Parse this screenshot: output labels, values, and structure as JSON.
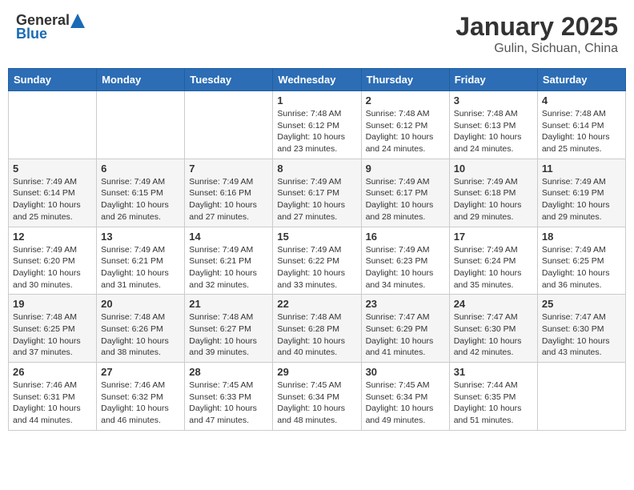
{
  "header": {
    "logo_general": "General",
    "logo_blue": "Blue",
    "month": "January 2025",
    "location": "Gulin, Sichuan, China"
  },
  "weekdays": [
    "Sunday",
    "Monday",
    "Tuesday",
    "Wednesday",
    "Thursday",
    "Friday",
    "Saturday"
  ],
  "weeks": [
    [
      {
        "day": "",
        "info": ""
      },
      {
        "day": "",
        "info": ""
      },
      {
        "day": "",
        "info": ""
      },
      {
        "day": "1",
        "info": "Sunrise: 7:48 AM\nSunset: 6:12 PM\nDaylight: 10 hours\nand 23 minutes."
      },
      {
        "day": "2",
        "info": "Sunrise: 7:48 AM\nSunset: 6:12 PM\nDaylight: 10 hours\nand 24 minutes."
      },
      {
        "day": "3",
        "info": "Sunrise: 7:48 AM\nSunset: 6:13 PM\nDaylight: 10 hours\nand 24 minutes."
      },
      {
        "day": "4",
        "info": "Sunrise: 7:48 AM\nSunset: 6:14 PM\nDaylight: 10 hours\nand 25 minutes."
      }
    ],
    [
      {
        "day": "5",
        "info": "Sunrise: 7:49 AM\nSunset: 6:14 PM\nDaylight: 10 hours\nand 25 minutes."
      },
      {
        "day": "6",
        "info": "Sunrise: 7:49 AM\nSunset: 6:15 PM\nDaylight: 10 hours\nand 26 minutes."
      },
      {
        "day": "7",
        "info": "Sunrise: 7:49 AM\nSunset: 6:16 PM\nDaylight: 10 hours\nand 27 minutes."
      },
      {
        "day": "8",
        "info": "Sunrise: 7:49 AM\nSunset: 6:17 PM\nDaylight: 10 hours\nand 27 minutes."
      },
      {
        "day": "9",
        "info": "Sunrise: 7:49 AM\nSunset: 6:17 PM\nDaylight: 10 hours\nand 28 minutes."
      },
      {
        "day": "10",
        "info": "Sunrise: 7:49 AM\nSunset: 6:18 PM\nDaylight: 10 hours\nand 29 minutes."
      },
      {
        "day": "11",
        "info": "Sunrise: 7:49 AM\nSunset: 6:19 PM\nDaylight: 10 hours\nand 29 minutes."
      }
    ],
    [
      {
        "day": "12",
        "info": "Sunrise: 7:49 AM\nSunset: 6:20 PM\nDaylight: 10 hours\nand 30 minutes."
      },
      {
        "day": "13",
        "info": "Sunrise: 7:49 AM\nSunset: 6:21 PM\nDaylight: 10 hours\nand 31 minutes."
      },
      {
        "day": "14",
        "info": "Sunrise: 7:49 AM\nSunset: 6:21 PM\nDaylight: 10 hours\nand 32 minutes."
      },
      {
        "day": "15",
        "info": "Sunrise: 7:49 AM\nSunset: 6:22 PM\nDaylight: 10 hours\nand 33 minutes."
      },
      {
        "day": "16",
        "info": "Sunrise: 7:49 AM\nSunset: 6:23 PM\nDaylight: 10 hours\nand 34 minutes."
      },
      {
        "day": "17",
        "info": "Sunrise: 7:49 AM\nSunset: 6:24 PM\nDaylight: 10 hours\nand 35 minutes."
      },
      {
        "day": "18",
        "info": "Sunrise: 7:49 AM\nSunset: 6:25 PM\nDaylight: 10 hours\nand 36 minutes."
      }
    ],
    [
      {
        "day": "19",
        "info": "Sunrise: 7:48 AM\nSunset: 6:25 PM\nDaylight: 10 hours\nand 37 minutes."
      },
      {
        "day": "20",
        "info": "Sunrise: 7:48 AM\nSunset: 6:26 PM\nDaylight: 10 hours\nand 38 minutes."
      },
      {
        "day": "21",
        "info": "Sunrise: 7:48 AM\nSunset: 6:27 PM\nDaylight: 10 hours\nand 39 minutes."
      },
      {
        "day": "22",
        "info": "Sunrise: 7:48 AM\nSunset: 6:28 PM\nDaylight: 10 hours\nand 40 minutes."
      },
      {
        "day": "23",
        "info": "Sunrise: 7:47 AM\nSunset: 6:29 PM\nDaylight: 10 hours\nand 41 minutes."
      },
      {
        "day": "24",
        "info": "Sunrise: 7:47 AM\nSunset: 6:30 PM\nDaylight: 10 hours\nand 42 minutes."
      },
      {
        "day": "25",
        "info": "Sunrise: 7:47 AM\nSunset: 6:30 PM\nDaylight: 10 hours\nand 43 minutes."
      }
    ],
    [
      {
        "day": "26",
        "info": "Sunrise: 7:46 AM\nSunset: 6:31 PM\nDaylight: 10 hours\nand 44 minutes."
      },
      {
        "day": "27",
        "info": "Sunrise: 7:46 AM\nSunset: 6:32 PM\nDaylight: 10 hours\nand 46 minutes."
      },
      {
        "day": "28",
        "info": "Sunrise: 7:45 AM\nSunset: 6:33 PM\nDaylight: 10 hours\nand 47 minutes."
      },
      {
        "day": "29",
        "info": "Sunrise: 7:45 AM\nSunset: 6:34 PM\nDaylight: 10 hours\nand 48 minutes."
      },
      {
        "day": "30",
        "info": "Sunrise: 7:45 AM\nSunset: 6:34 PM\nDaylight: 10 hours\nand 49 minutes."
      },
      {
        "day": "31",
        "info": "Sunrise: 7:44 AM\nSunset: 6:35 PM\nDaylight: 10 hours\nand 51 minutes."
      },
      {
        "day": "",
        "info": ""
      }
    ]
  ]
}
